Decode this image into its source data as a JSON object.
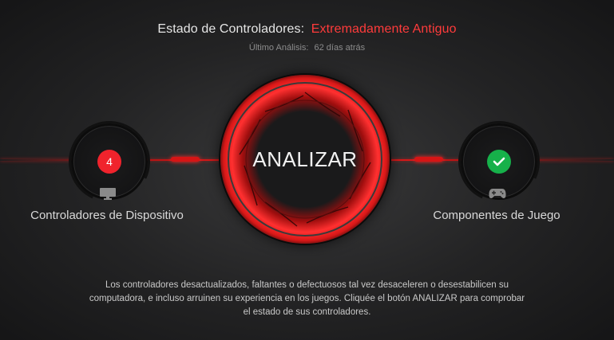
{
  "header": {
    "status_label": "Estado de Controladores:",
    "status_value": "Extremadamente Antiguo",
    "last_scan_label": "Último Análisis:",
    "last_scan_value": "62 días atrás"
  },
  "left_panel": {
    "count": "4",
    "icon": "monitor-icon",
    "label": "Controladores de Dispositivo"
  },
  "center": {
    "button_label": "ANALIZAR"
  },
  "right_panel": {
    "icon": "gamepad-icon",
    "status_icon": "checkmark-icon",
    "label": "Componentes de Juego"
  },
  "description": "Los controladores desactualizados, faltantes o defectuosos tal vez desaceleren o desestabilicen su computadora, e incluso arruinen su experiencia en los juegos. Cliquée el botón ANALIZAR para comprobar el estado de sus controladores.",
  "colors": {
    "accent_red": "#ff3b3b",
    "badge_red": "#f0232c",
    "badge_green": "#16b14a",
    "background": "#232324"
  }
}
